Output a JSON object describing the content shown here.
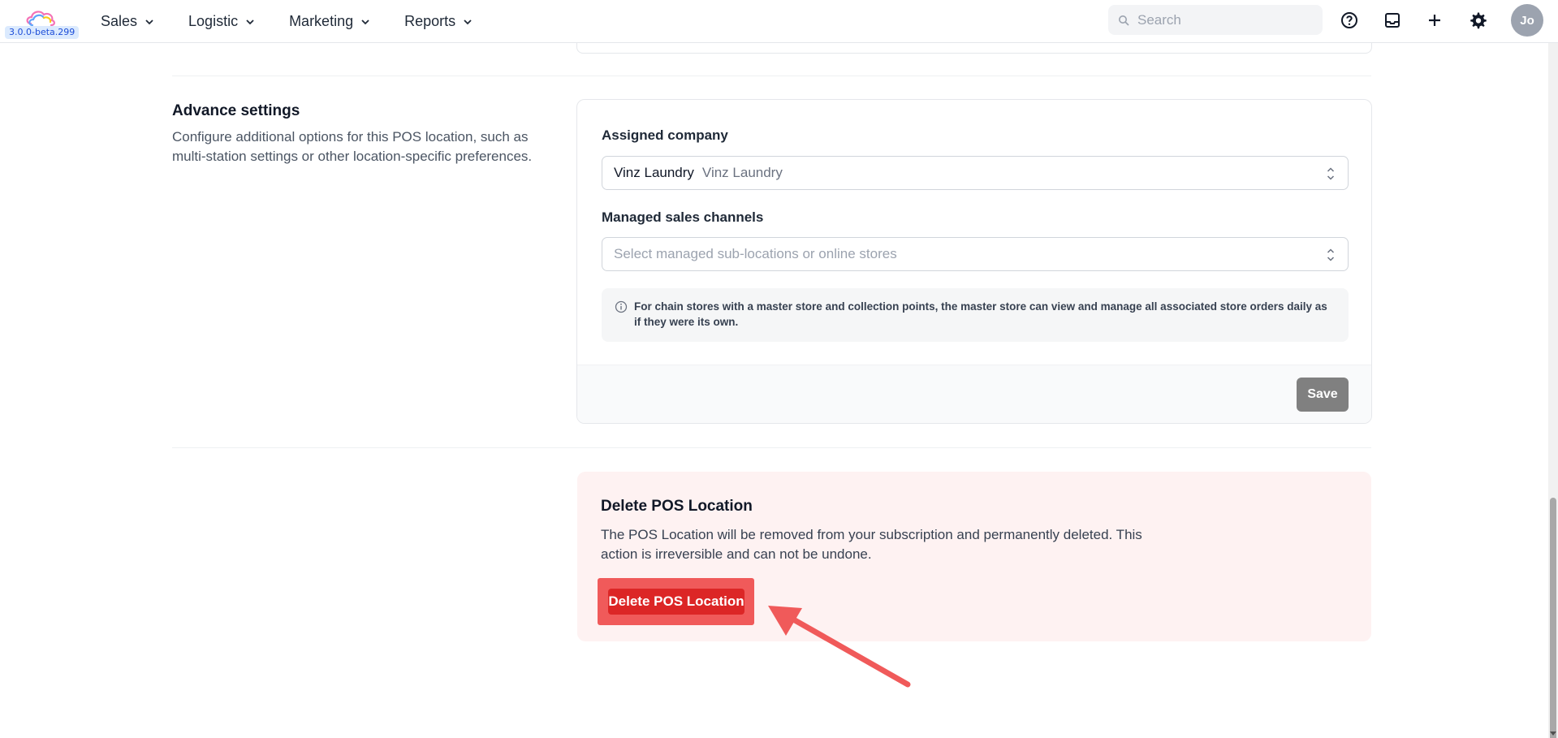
{
  "app": {
    "version": "3.0.0-beta.299",
    "colors": {
      "danger": "#dc2626",
      "danger_bg": "#fef2f2",
      "highlight": "#f05a5a"
    }
  },
  "nav": {
    "items": [
      {
        "label": "Sales",
        "icon": "chevron-down-icon"
      },
      {
        "label": "Logistic",
        "icon": "chevron-down-icon"
      },
      {
        "label": "Marketing",
        "icon": "chevron-down-icon"
      },
      {
        "label": "Reports",
        "icon": "chevron-down-icon"
      }
    ],
    "search_placeholder": "Search",
    "icons": [
      "help-icon",
      "inbox-icon",
      "plus-icon",
      "gear-icon"
    ],
    "avatar_initials": "Jo"
  },
  "advance": {
    "title": "Advance settings",
    "description": "Configure additional options for this POS location, such as multi-station settings or other location-specific preferences.",
    "assigned_company_label": "Assigned company",
    "assigned_company_value": "Vinz Laundry",
    "assigned_company_sub": "Vinz Laundry",
    "managed_channels_label": "Managed sales channels",
    "managed_channels_placeholder": "Select managed sub-locations or online stores",
    "info_text": "For chain stores with a master store and collection points, the master store can view and manage all associated store orders daily as if they were its own.",
    "save_label": "Save"
  },
  "danger": {
    "title": "Delete POS Location",
    "description": "The POS Location will be removed from your subscription and permanently deleted. This action is irreversible and can not be undone.",
    "button_label": "Delete POS Location"
  }
}
